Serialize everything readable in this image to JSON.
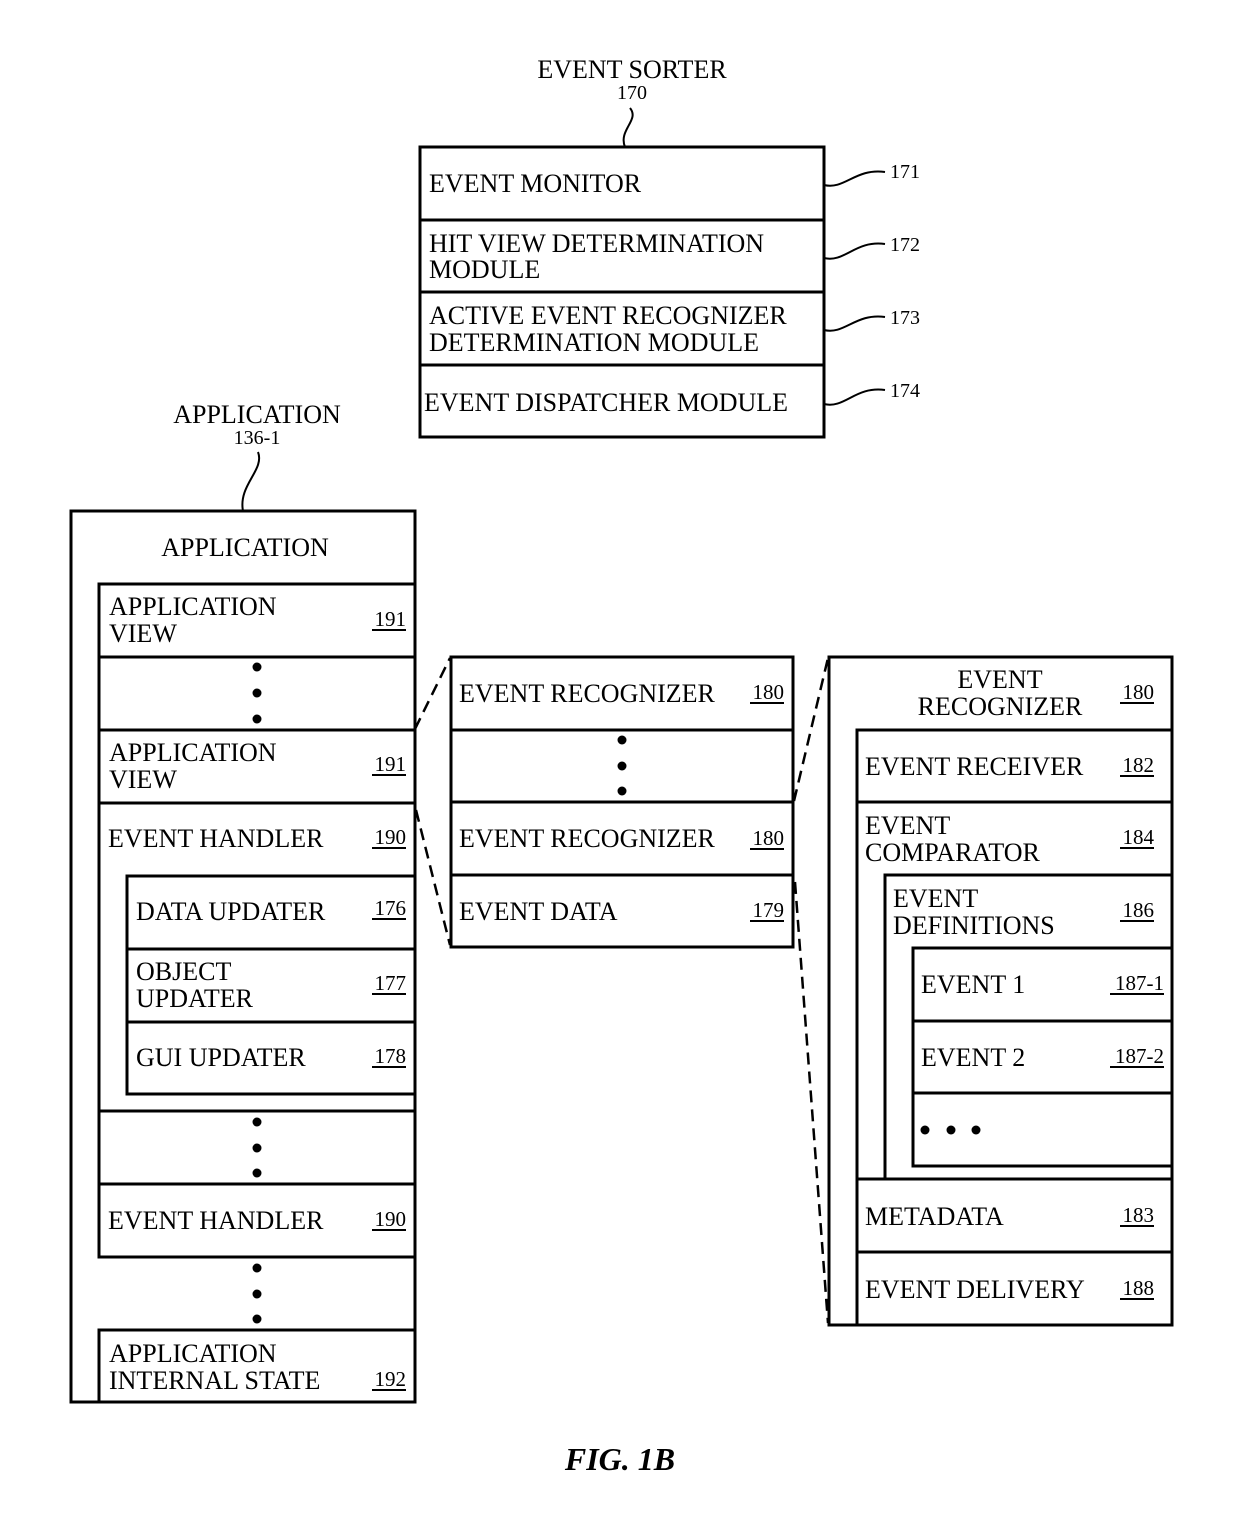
{
  "event_sorter": {
    "title": "EVENT SORTER",
    "ref": "170",
    "rows": [
      {
        "lines": [
          "EVENT MONITOR"
        ],
        "ref": "171"
      },
      {
        "lines": [
          "HIT VIEW DETERMINATION",
          "MODULE"
        ],
        "ref": "172"
      },
      {
        "lines": [
          "ACTIVE EVENT RECOGNIZER",
          "DETERMINATION MODULE"
        ],
        "ref": "173"
      },
      {
        "lines": [
          "EVENT DISPATCHER MODULE"
        ],
        "ref": "174"
      }
    ]
  },
  "application": {
    "caption": "APPLICATION",
    "ref": "136-1",
    "header": "APPLICATION",
    "app_view_1": {
      "lines": [
        "APPLICATION",
        "VIEW"
      ],
      "ref": "191"
    },
    "app_view_2": {
      "lines": [
        "APPLICATION",
        "VIEW"
      ],
      "ref": "191"
    },
    "event_handler_1": {
      "label": "EVENT HANDLER",
      "ref": "190"
    },
    "data_updater": {
      "label": "DATA UPDATER",
      "ref": "176"
    },
    "object_updater": {
      "lines": [
        "OBJECT",
        "UPDATER"
      ],
      "ref": "177"
    },
    "gui_updater": {
      "label": "GUI UPDATER",
      "ref": "178"
    },
    "event_handler_2": {
      "label": "EVENT HANDLER",
      "ref": "190"
    },
    "internal_state": {
      "lines": [
        "APPLICATION",
        "INTERNAL STATE"
      ],
      "ref": "192"
    }
  },
  "recognizers": {
    "recognizer_1": {
      "label": "EVENT RECOGNIZER",
      "ref": "180"
    },
    "recognizer_2": {
      "label": "EVENT RECOGNIZER",
      "ref": "180"
    },
    "event_data": {
      "label": "EVENT DATA",
      "ref": "179"
    }
  },
  "recognizer_detail": {
    "header": {
      "lines": [
        "EVENT",
        "RECOGNIZER"
      ],
      "ref": "180"
    },
    "receiver": {
      "label": "EVENT RECEIVER",
      "ref": "182"
    },
    "comparator": {
      "lines": [
        "EVENT",
        "COMPARATOR"
      ],
      "ref": "184"
    },
    "definitions": {
      "lines": [
        "EVENT",
        "DEFINITIONS"
      ],
      "ref": "186"
    },
    "event_1": {
      "label": "EVENT 1",
      "ref": "187-1"
    },
    "event_2": {
      "label": "EVENT 2",
      "ref": "187-2"
    },
    "metadata": {
      "label": "METADATA",
      "ref": "183"
    },
    "delivery": {
      "label": "EVENT DELIVERY",
      "ref": "188"
    }
  },
  "figure_label": "FIG. 1B"
}
